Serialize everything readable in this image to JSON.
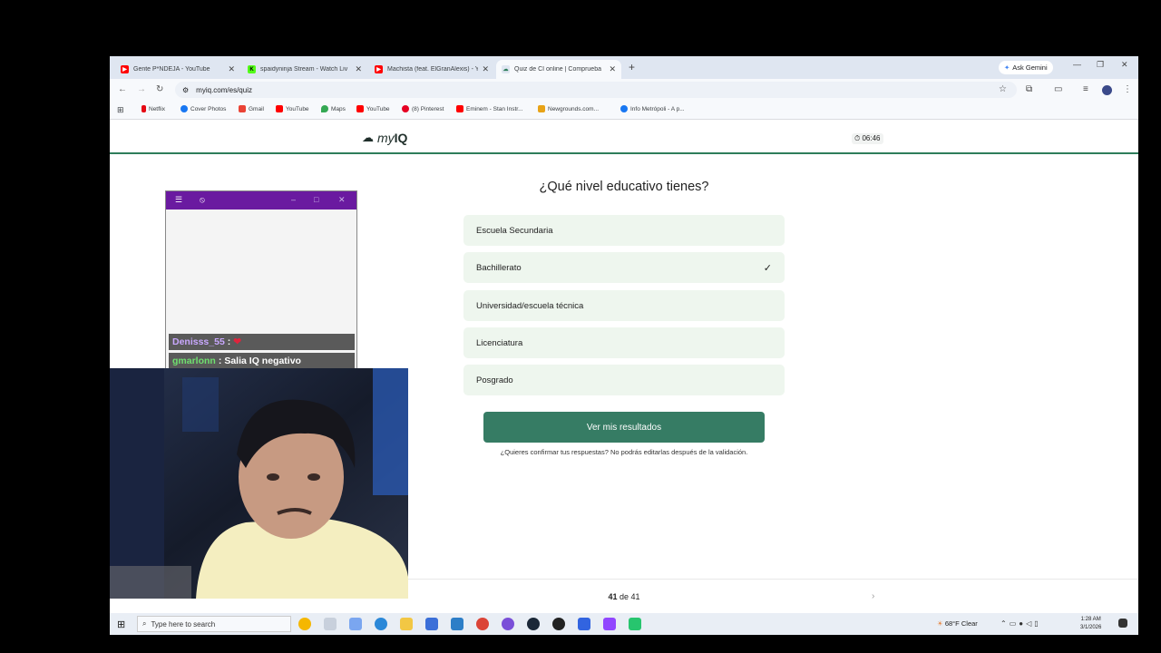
{
  "browser": {
    "tabs": [
      {
        "title": "Gente P*NDEJA - YouTube",
        "favicon_color": "#ff0000",
        "icon": "youtube-icon",
        "active": false
      },
      {
        "title": "spaidyninja Stream - Watch Liv",
        "favicon_color": "#53fc18",
        "icon": "kick-icon",
        "active": false
      },
      {
        "title": "Machista (feat. ElGranAlexis) - Y",
        "favicon_color": "#ff0000",
        "icon": "youtube-icon",
        "active": false
      },
      {
        "title": "Quiz de CI online | Comprueba",
        "favicon_color": "#2e7d5b",
        "icon": "brain-icon",
        "active": true
      }
    ],
    "ask_gemini": "Ask Gemini",
    "url": "myiq.com/es/quiz",
    "bookmarks": [
      {
        "label": "Netflix",
        "color": "#e50914",
        "icon": "netflix-icon"
      },
      {
        "label": "Cover Photos",
        "color": "#1877f2",
        "icon": "facebook-icon"
      },
      {
        "label": "Gmail",
        "color": "#ea4335",
        "icon": "gmail-icon"
      },
      {
        "label": "YouTube",
        "color": "#ff0000",
        "icon": "youtube-icon"
      },
      {
        "label": "Maps",
        "color": "#34a853",
        "icon": "maps-icon"
      },
      {
        "label": "YouTube",
        "color": "#ff0000",
        "icon": "youtube-icon"
      },
      {
        "label": "(8) Pinterest",
        "color": "#e60023",
        "icon": "pinterest-icon"
      },
      {
        "label": "Eminem - Stan Instr...",
        "color": "#ff0000",
        "icon": "youtube-icon"
      },
      {
        "label": "Newgrounds.com...",
        "color": "#e8a317",
        "icon": "newgrounds-icon"
      },
      {
        "label": "Info Metrópoli - A p...",
        "color": "#1877f2",
        "icon": "facebook-icon"
      }
    ]
  },
  "site": {
    "logo_prefix": "my",
    "logo_suffix": "IQ",
    "timer": "06:46",
    "accent": "#2e7d5b"
  },
  "quiz": {
    "question": "¿Qué nivel educativo tienes?",
    "options": [
      {
        "label": "Escuela Secundaria",
        "selected": false
      },
      {
        "label": "Bachillerato",
        "selected": true
      },
      {
        "label": "Universidad/escuela técnica",
        "selected": false
      },
      {
        "label": "Licenciatura",
        "selected": false
      },
      {
        "label": "Posgrado",
        "selected": false
      }
    ],
    "submit_label": "Ver mis resultados",
    "confirm_note": "¿Quieres confirmar tus respuestas? No podrás editarlas después de la validación.",
    "page_current": "41",
    "page_sep": "de",
    "page_total": "41"
  },
  "chat": {
    "messages": [
      {
        "user": "Denisss_55",
        "text": "❤"
      },
      {
        "user": "gmarlonn",
        "text": "Salia IQ negativo"
      }
    ]
  },
  "taskbar": {
    "search_placeholder": "Type here to search",
    "weather_temp": "68°F",
    "weather_text": "Clear",
    "time": "1:28 AM",
    "date": "3/1/2026"
  }
}
